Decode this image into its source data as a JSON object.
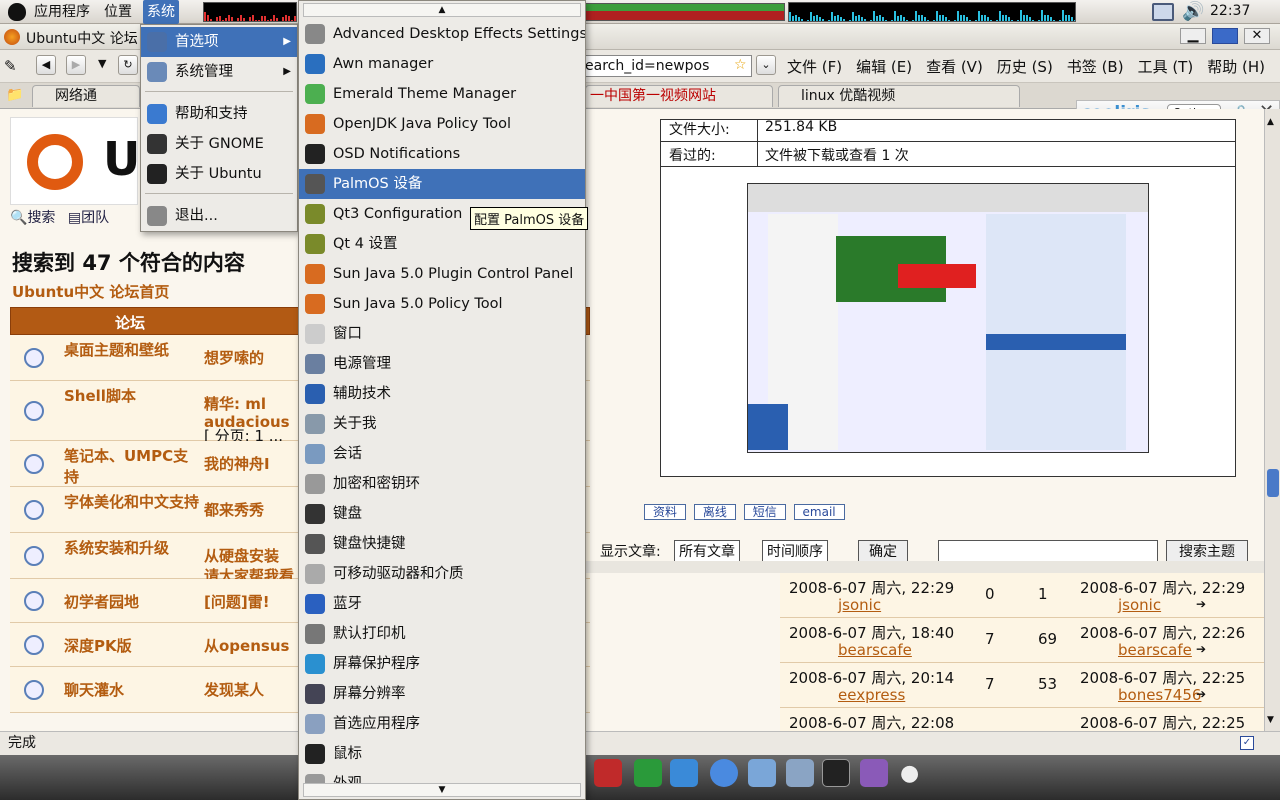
{
  "panel": {
    "menus": [
      "应用程序",
      "位置",
      "系统"
    ],
    "clock": "22:37"
  },
  "firefox": {
    "title": "Ubuntu中文 论坛",
    "address": "earch_id=newpos",
    "menubar": [
      "文件 (F)",
      "编辑 (E)",
      "查看 (V)",
      "历史 (S)",
      "书签 (B)",
      "工具 (T)",
      "帮助 (H)"
    ],
    "tabs": [
      "网络通",
      "一中国第一视频网站",
      "linux 优酷视频"
    ],
    "status": "完成"
  },
  "cooliris": {
    "brand": "cooliris",
    "options": "Options"
  },
  "system_menu": {
    "items": [
      {
        "label": "首选项",
        "icon": "preferences-icon"
      },
      {
        "label": "系统管理",
        "icon": "admin-icon"
      },
      {
        "label": "帮助和支持",
        "icon": "help-icon"
      },
      {
        "label": "关于 GNOME",
        "icon": "gnome-icon"
      },
      {
        "label": "关于 Ubuntu",
        "icon": "ubuntu-icon"
      },
      {
        "label": "退出...",
        "icon": "power-icon"
      }
    ]
  },
  "prefs_menu": {
    "items": [
      {
        "label": "Advanced Desktop Effects Settings",
        "color": "#888"
      },
      {
        "label": "Awn manager",
        "color": "#2a6fbf"
      },
      {
        "label": "Emerald Theme Manager",
        "color": "#4caf50"
      },
      {
        "label": "OpenJDK Java  Policy Tool",
        "color": "#d86b20"
      },
      {
        "label": "OSD Notifications",
        "color": "#222"
      },
      {
        "label": "PalmOS 设备",
        "color": "#555"
      },
      {
        "label": "Qt3 Configuration",
        "color": "#7a8a2a"
      },
      {
        "label": "Qt 4 设置",
        "color": "#7a8a2a"
      },
      {
        "label": "Sun Java 5.0 Plugin Control Panel",
        "color": "#d86b20"
      },
      {
        "label": "Sun Java 5.0 Policy Tool",
        "color": "#d86b20"
      },
      {
        "label": "窗口",
        "color": "#ccc"
      },
      {
        "label": "电源管理",
        "color": "#6a7fa0"
      },
      {
        "label": "辅助技术",
        "color": "#2a5fb0"
      },
      {
        "label": "关于我",
        "color": "#8899aa"
      },
      {
        "label": "会话",
        "color": "#7a9ac0"
      },
      {
        "label": "加密和密钥环",
        "color": "#999"
      },
      {
        "label": "键盘",
        "color": "#333"
      },
      {
        "label": "键盘快捷键",
        "color": "#555"
      },
      {
        "label": "可移动驱动器和介质",
        "color": "#aaa"
      },
      {
        "label": "蓝牙",
        "color": "#2a60c0"
      },
      {
        "label": "默认打印机",
        "color": "#777"
      },
      {
        "label": "屏幕保护程序",
        "color": "#2a90d0"
      },
      {
        "label": "屏幕分辨率",
        "color": "#445"
      },
      {
        "label": "首选应用程序",
        "color": "#8aa0c0"
      },
      {
        "label": "鼠标",
        "color": "#222"
      },
      {
        "label": "外观",
        "color": "#999"
      }
    ],
    "highlighted": "PalmOS 设备",
    "tooltip": "配置 PalmOS 设备"
  },
  "page": {
    "search_links": [
      "搜索",
      "团队"
    ],
    "heading_prefix": "搜索到",
    "heading_count": "47",
    "heading_suffix": "个符合的内容",
    "breadcrumb": "Ubuntu中文 论坛首页",
    "col_forum": "论坛",
    "file_size_label": "文件大小:",
    "file_size": "251.84 KB",
    "viewed_label": "看过的:",
    "viewed": "文件被下载或查看 1 次",
    "profile_buttons": [
      "资料",
      "离线",
      "短信",
      "email"
    ],
    "sort": {
      "label": "显示文章:",
      "all": "所有文章",
      "order": "时间顺序",
      "go": "确定",
      "search_btn": "搜索主题"
    },
    "rows": [
      {
        "forum": "桌面主题和壁纸",
        "topic": "想罗嗦的",
        "date": "2008-6-07 周六, 22:29",
        "author": "jsonic",
        "replies": "0",
        "views": "1",
        "last_date": "2008-6-07 周六, 22:29",
        "last_author": "jsonic"
      },
      {
        "forum": "Shell脚本",
        "topic": "精华: ml",
        "topic2": "audacious",
        "pages": "[ 分页: 1 ..."
      },
      {
        "forum": "笔记本、UMPC支持",
        "topic": "我的神舟I",
        "date": "2008-6-07 周六, 18:40",
        "author": "bearscafe",
        "replies": "7",
        "views": "69",
        "last_date": "2008-6-07 周六, 22:26",
        "last_author": "bearscafe"
      },
      {
        "forum": "字体美化和中文支持",
        "topic": "都来秀秀",
        "date": "2008-6-07 周六, 20:14",
        "author": "eexpress",
        "replies": "7",
        "views": "53",
        "last_date": "2008-6-07 周六, 22:25",
        "last_author": "bones7456"
      },
      {
        "forum": "系统安装和升级",
        "topic": "从硬盘安装",
        "topic2": "请大家帮我看",
        "date": "2008-6-07 周六, 22:08",
        "last_date": "2008-6-07 周六, 22:25"
      },
      {
        "forum": "初学者园地",
        "topic": "[问题]雷!"
      },
      {
        "forum": "深度PK版",
        "topic": "从opensus"
      },
      {
        "forum": "聊天灌水",
        "topic": "发现某人"
      }
    ]
  }
}
